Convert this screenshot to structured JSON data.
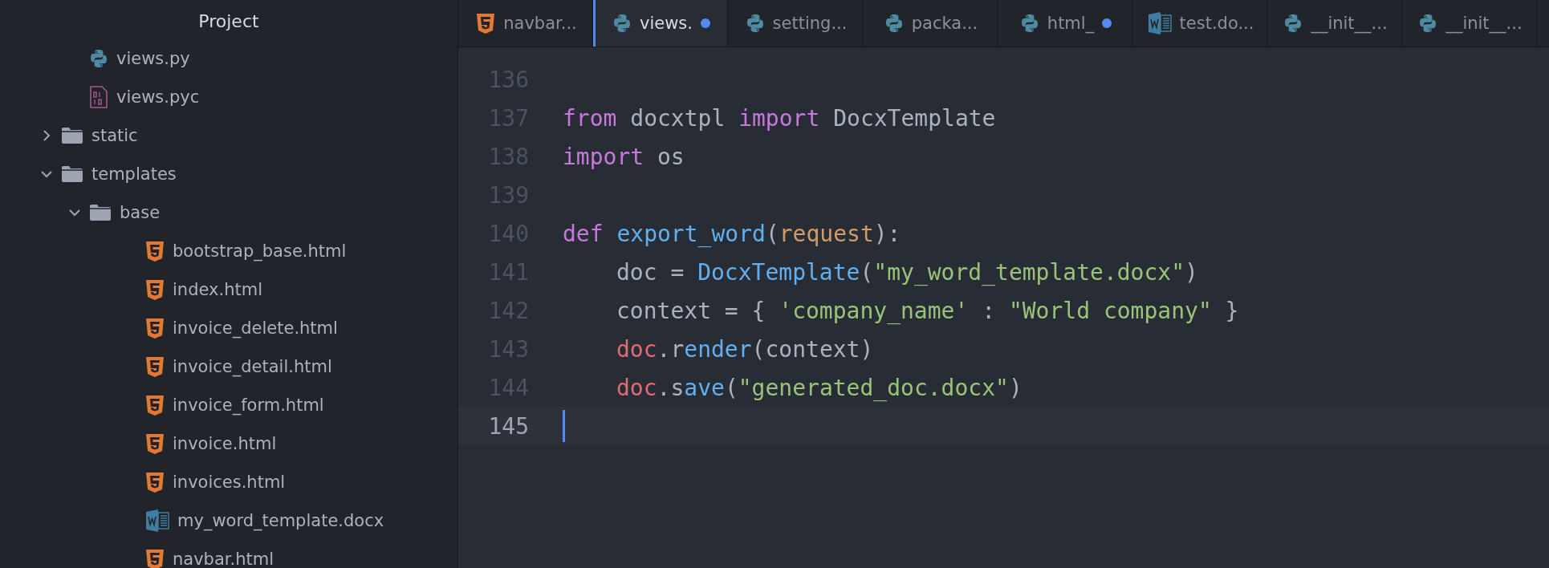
{
  "sidebar": {
    "title": "Project",
    "tree": [
      {
        "kind": "python",
        "label": "views.py"
      },
      {
        "kind": "binary",
        "label": "views.pyc"
      },
      {
        "kind": "folder",
        "label": "static",
        "expanded": false
      },
      {
        "kind": "folder",
        "label": "templates",
        "expanded": true,
        "children": [
          {
            "kind": "folder",
            "label": "base",
            "expanded": true,
            "children": [
              {
                "kind": "html",
                "label": "bootstrap_base.html"
              },
              {
                "kind": "html",
                "label": "index.html"
              },
              {
                "kind": "html",
                "label": "invoice_delete.html"
              },
              {
                "kind": "html",
                "label": "invoice_detail.html"
              },
              {
                "kind": "html",
                "label": "invoice_form.html"
              },
              {
                "kind": "html",
                "label": "invoice.html"
              },
              {
                "kind": "html",
                "label": "invoices.html"
              },
              {
                "kind": "word",
                "label": "my_word_template.docx"
              },
              {
                "kind": "html",
                "label": "navbar.html"
              }
            ]
          }
        ]
      }
    ]
  },
  "tabs": [
    {
      "kind": "html",
      "label": "navbar...",
      "selected": false,
      "modified": false
    },
    {
      "kind": "python",
      "label": "views.",
      "selected": true,
      "modified": true
    },
    {
      "kind": "python",
      "label": "setting...",
      "selected": false,
      "modified": false
    },
    {
      "kind": "python",
      "label": "packa...",
      "selected": false,
      "modified": false
    },
    {
      "kind": "python",
      "label": "html_",
      "selected": false,
      "modified": true
    },
    {
      "kind": "word",
      "label": "test.do...",
      "selected": false,
      "modified": false
    },
    {
      "kind": "python",
      "label": "__init__...",
      "selected": false,
      "modified": false
    },
    {
      "kind": "python",
      "label": "__init__...",
      "selected": false,
      "modified": false
    }
  ],
  "editor": {
    "lines": [
      {
        "number": "136",
        "current": false
      },
      {
        "number": "137",
        "current": false,
        "tokens": [
          {
            "kind": "keyword",
            "text": "from"
          },
          {
            "kind": "plain",
            "text": " docxtpl "
          },
          {
            "kind": "keyword",
            "text": "import"
          },
          {
            "kind": "plain",
            "text": " DocxTemplate"
          }
        ]
      },
      {
        "number": "138",
        "current": false,
        "tokens": [
          {
            "kind": "keyword",
            "text": "import"
          },
          {
            "kind": "plain",
            "text": " os"
          }
        ]
      },
      {
        "number": "139",
        "current": false
      },
      {
        "number": "140",
        "current": false,
        "tokens": [
          {
            "kind": "keyword",
            "text": "def"
          },
          {
            "kind": "function",
            "text": " export_word"
          },
          {
            "kind": "plain",
            "text": "("
          },
          {
            "kind": "param",
            "text": "request"
          },
          {
            "kind": "plain",
            "text": "):"
          }
        ],
        "children": [
          {
            "number": "141",
            "current": false,
            "tokens": [
              {
                "kind": "plain",
                "text": "doc = "
              },
              {
                "kind": "function",
                "text": "DocxTemplate"
              },
              {
                "kind": "plain",
                "text": "("
              },
              {
                "kind": "string",
                "text": "\"my_word_template.docx\""
              },
              {
                "kind": "plain",
                "text": ")"
              }
            ]
          },
          {
            "number": "142",
            "current": false,
            "tokens": [
              {
                "kind": "plain",
                "text": "context = { "
              },
              {
                "kind": "string",
                "text": "'company_name'"
              },
              {
                "kind": "plain",
                "text": " : "
              },
              {
                "kind": "string",
                "text": "\"World company\""
              },
              {
                "kind": "plain",
                "text": " }"
              }
            ]
          },
          {
            "number": "143",
            "current": false,
            "tokens": [
              {
                "kind": "variable",
                "text": "doc"
              },
              {
                "kind": "method",
                "text": ".render"
              },
              {
                "kind": "plain",
                "text": "(context)"
              }
            ]
          },
          {
            "number": "144",
            "current": false,
            "tokens": [
              {
                "kind": "variable",
                "text": "doc"
              },
              {
                "kind": "method",
                "text": ".save"
              },
              {
                "kind": "plain",
                "text": "("
              },
              {
                "kind": "string",
                "text": "\"generated_doc.docx\""
              },
              {
                "kind": "plain",
                "text": ")"
              }
            ]
          }
        ]
      },
      {
        "number": "145",
        "current": true
      }
    ]
  }
}
